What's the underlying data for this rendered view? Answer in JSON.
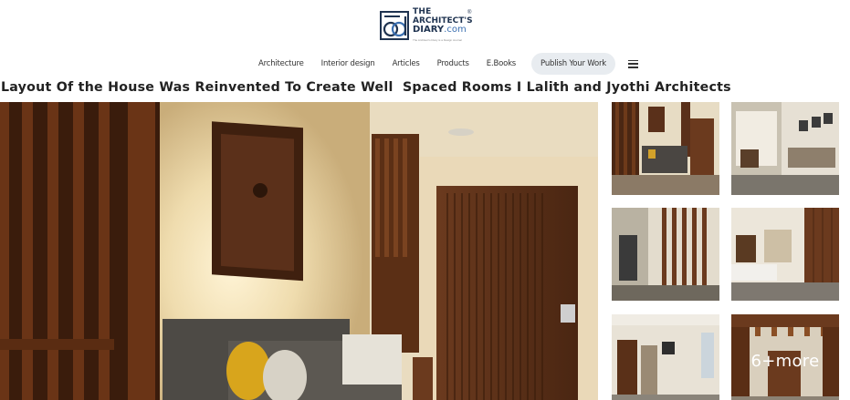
{
  "logo": {
    "line1": "THE",
    "line2": "ARCHITECT'S",
    "line3_word": "DIARY",
    "line3_dot": ".com",
    "tagline": "The Architect's Diary is a Design Journal",
    "registered": "®",
    "brand_color": "#1f3350",
    "accent_color": "#3a6fb0"
  },
  "nav": {
    "items": [
      "Architecture",
      "Interior design",
      "Articles",
      "Products",
      "E.Books"
    ],
    "publish_label": "Publish Your Work",
    "menu_icon": "hamburger-menu-icon"
  },
  "article": {
    "title": "Layout Of the House Was Reinvented To Create Well  Spaced Rooms I Lalith and Jyothi Architects"
  },
  "gallery": {
    "more_label": "6+more",
    "thumbnail_count": 6
  }
}
